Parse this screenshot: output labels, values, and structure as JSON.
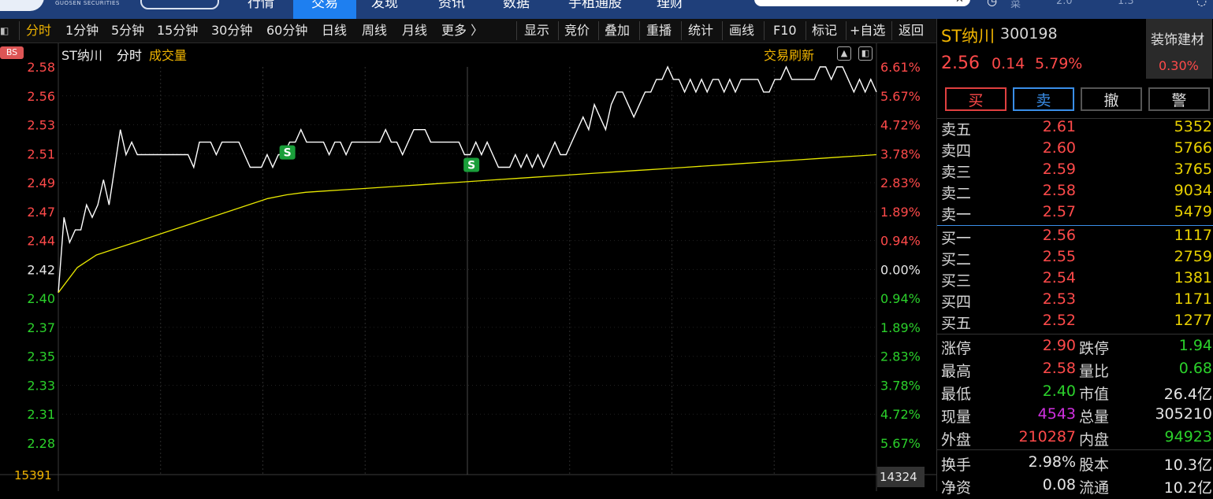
{
  "colors": {
    "up": "#ff4a4a",
    "down": "#2bd12b",
    "neutral": "#e6e6e6",
    "accent": "#f0b400",
    "price_line": "#ffffff",
    "avg_line": "#e8e800",
    "nav_bg": "#1f3f7a",
    "nav_active": "#1e7ff0",
    "sell_marker": "#1a9e3a"
  },
  "nav": {
    "brand": "GUOSEN SECURITIES",
    "tabs": [
      {
        "label": "行情",
        "active": false
      },
      {
        "label": "交易",
        "active": true
      },
      {
        "label": "发现",
        "active": false
      },
      {
        "label": "资讯",
        "active": false
      },
      {
        "label": "数据",
        "active": false
      },
      {
        "label": "手租通股",
        "active": false
      },
      {
        "label": "理财",
        "active": false
      }
    ],
    "right_items": [
      "菜",
      "2.0",
      "1.3"
    ]
  },
  "periodbar": {
    "items": [
      "分时",
      "1分钟",
      "5分钟",
      "15分钟",
      "30分钟",
      "60分钟",
      "日线",
      "周线",
      "月线",
      "更多 〉"
    ],
    "active": "分时",
    "tools": [
      "显示",
      "竞价",
      "叠加",
      "重播",
      "统计",
      "画线",
      "F10",
      "标记",
      "+自选",
      "返回"
    ]
  },
  "chart_header": {
    "bs_badge": "BS",
    "stock": "ST纳川",
    "mode": "分时",
    "indicator": "成交量",
    "refresh": "交易刷新"
  },
  "chart_data": {
    "type": "line",
    "title": "ST纳川 分时",
    "prev_close": 2.42,
    "ylim": [
      2.26,
      2.59
    ],
    "y_ticks_left": [
      "2.58",
      "2.56",
      "2.53",
      "2.51",
      "2.49",
      "2.47",
      "2.44",
      "2.42",
      "2.40",
      "2.37",
      "2.35",
      "2.33",
      "2.31",
      "2.28"
    ],
    "y_ticks_right": [
      "6.61%",
      "5.67%",
      "4.72%",
      "3.78%",
      "2.83%",
      "1.89%",
      "0.94%",
      "0.00%",
      "0.94%",
      "1.89%",
      "2.83%",
      "3.78%",
      "4.72%",
      "5.67%"
    ],
    "volume_left": "15391",
    "volume_right": "14324",
    "series": [
      {
        "name": "price",
        "values": [
          2.4,
          2.46,
          2.44,
          2.45,
          2.45,
          2.47,
          2.46,
          2.47,
          2.49,
          2.47,
          2.5,
          2.53,
          2.51,
          2.52,
          2.51,
          2.51,
          2.51,
          2.51,
          2.51,
          2.51,
          2.51,
          2.51,
          2.51,
          2.51,
          2.5,
          2.52,
          2.52,
          2.52,
          2.51,
          2.52,
          2.52,
          2.52,
          2.52,
          2.51,
          2.5,
          2.5,
          2.5,
          2.51,
          2.5,
          2.51,
          2.51,
          2.52,
          2.52,
          2.53,
          2.52,
          2.52,
          2.52,
          2.52,
          2.51,
          2.52,
          2.52,
          2.51,
          2.52,
          2.52,
          2.52,
          2.52,
          2.52,
          2.52,
          2.53,
          2.52,
          2.52,
          2.51,
          2.52,
          2.53,
          2.53,
          2.53,
          2.52,
          2.52,
          2.52,
          2.52,
          2.52,
          2.52,
          2.51,
          2.51,
          2.52,
          2.51,
          2.52,
          2.51,
          2.5,
          2.5,
          2.5,
          2.51,
          2.5,
          2.51,
          2.5,
          2.51,
          2.5,
          2.51,
          2.52,
          2.51,
          2.51,
          2.52,
          2.53,
          2.54,
          2.53,
          2.55,
          2.54,
          2.53,
          2.55,
          2.56,
          2.56,
          2.55,
          2.54,
          2.55,
          2.56,
          2.56,
          2.57,
          2.57,
          2.58,
          2.57,
          2.57,
          2.56,
          2.57,
          2.56,
          2.57,
          2.56,
          2.57,
          2.57,
          2.56,
          2.57,
          2.56,
          2.57,
          2.57,
          2.57,
          2.57,
          2.56,
          2.56,
          2.57,
          2.57,
          2.58,
          2.57,
          2.57,
          2.57,
          2.57,
          2.57,
          2.58,
          2.58,
          2.57,
          2.58,
          2.58,
          2.57,
          2.56,
          2.57,
          2.56,
          2.57,
          2.56
        ]
      },
      {
        "name": "average",
        "values": [
          2.4,
          2.42,
          2.43,
          2.435,
          2.44,
          2.445,
          2.45,
          2.455,
          2.46,
          2.465,
          2.47,
          2.475,
          2.478,
          2.48,
          2.481,
          2.482,
          2.483,
          2.484,
          2.485,
          2.486,
          2.487,
          2.488,
          2.489,
          2.49,
          2.491,
          2.492,
          2.493,
          2.494,
          2.495,
          2.496,
          2.497,
          2.498,
          2.499,
          2.5,
          2.501,
          2.502,
          2.503,
          2.504,
          2.505,
          2.506,
          2.507,
          2.508,
          2.509,
          2.51
        ]
      }
    ],
    "markers": [
      {
        "label": "S",
        "x_fraction": 0.28
      },
      {
        "label": "S",
        "x_fraction": 0.505
      }
    ]
  },
  "quote": {
    "name": "ST纳川",
    "code": "300198",
    "price": "2.56",
    "change": "0.14",
    "change_pct": "5.79%",
    "sector": "装饰建材",
    "sector_pct": "0.30%",
    "buttons": {
      "buy": "买",
      "sell": "卖",
      "cancel": "撤",
      "alert": "警"
    }
  },
  "orderbook": {
    "asks": [
      {
        "label": "卖五",
        "price": "2.61",
        "vol": "5352"
      },
      {
        "label": "卖四",
        "price": "2.60",
        "vol": "5766"
      },
      {
        "label": "卖三",
        "price": "2.59",
        "vol": "3765"
      },
      {
        "label": "卖二",
        "price": "2.58",
        "vol": "9034"
      },
      {
        "label": "卖一",
        "price": "2.57",
        "vol": "5479"
      }
    ],
    "bids": [
      {
        "label": "买一",
        "price": "2.56",
        "vol": "1117"
      },
      {
        "label": "买二",
        "price": "2.55",
        "vol": "2759"
      },
      {
        "label": "买三",
        "price": "2.54",
        "vol": "1381"
      },
      {
        "label": "买四",
        "price": "2.53",
        "vol": "1171"
      },
      {
        "label": "买五",
        "price": "2.52",
        "vol": "1277"
      }
    ]
  },
  "stats": [
    {
      "l1": "涨停",
      "v1": "2.90",
      "c1": "up",
      "l2": "跌停",
      "v2": "1.94",
      "c2": "down"
    },
    {
      "l1": "最高",
      "v1": "2.58",
      "c1": "up",
      "l2": "量比",
      "v2": "0.68",
      "c2": "down"
    },
    {
      "l1": "最低",
      "v1": "2.40",
      "c1": "down",
      "l2": "市值",
      "v2": "26.4亿",
      "c2": "neutral"
    },
    {
      "l1": "现量",
      "v1": "4543",
      "c1": "purple",
      "l2": "总量",
      "v2": "305210",
      "c2": "neutral"
    },
    {
      "l1": "外盘",
      "v1": "210287",
      "c1": "up",
      "l2": "内盘",
      "v2": "94923",
      "c2": "down"
    },
    {
      "l1": "换手",
      "v1": "2.98%",
      "c1": "neutral",
      "l2": "股本",
      "v2": "10.3亿",
      "c2": "neutral"
    },
    {
      "l1": "净资",
      "v1": "0.08",
      "c1": "neutral",
      "l2": "流通",
      "v2": "10.2亿",
      "c2": "neutral"
    }
  ]
}
